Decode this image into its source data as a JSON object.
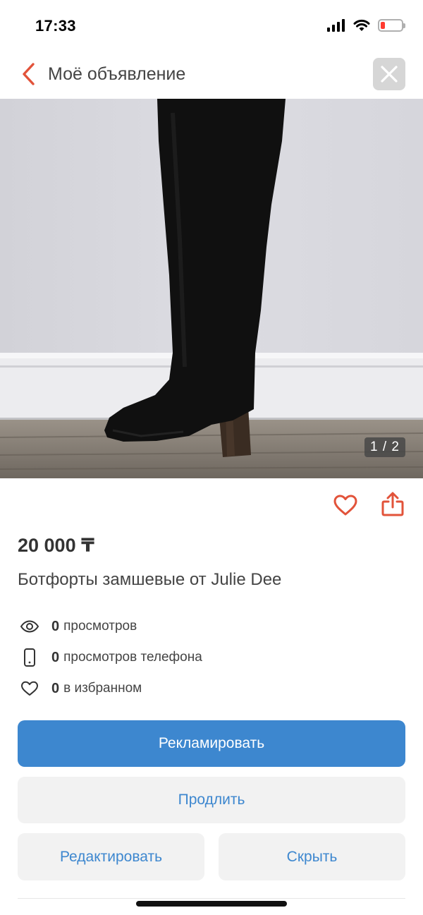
{
  "status_bar": {
    "time": "17:33",
    "icons": [
      "signal-icon",
      "wifi-icon",
      "battery-low-icon"
    ]
  },
  "nav": {
    "title": "Моё объявление",
    "back_icon": "chevron-left-icon",
    "close_icon": "close-icon"
  },
  "photo": {
    "counter": "1 / 2"
  },
  "actions": {
    "favorite_icon": "heart-outline-icon",
    "share_icon": "share-icon"
  },
  "listing": {
    "price": "20 000 ₸",
    "title": "Ботфорты замшевые от Julie Dee"
  },
  "stats": [
    {
      "icon": "eye-icon",
      "count": "0",
      "label": "просмотров"
    },
    {
      "icon": "phone-icon",
      "count": "0",
      "label": "просмотров телефона"
    },
    {
      "icon": "heart-icon",
      "count": "0",
      "label": "в избранном"
    }
  ],
  "buttons": {
    "promote": "Рекламировать",
    "prolong": "Продлить",
    "edit": "Редактировать",
    "hide": "Скрыть"
  },
  "colors": {
    "accent_red": "#e2533a",
    "primary_blue": "#3d87cf",
    "button_gray": "#f2f2f2",
    "battery_red": "#ff3b30"
  }
}
